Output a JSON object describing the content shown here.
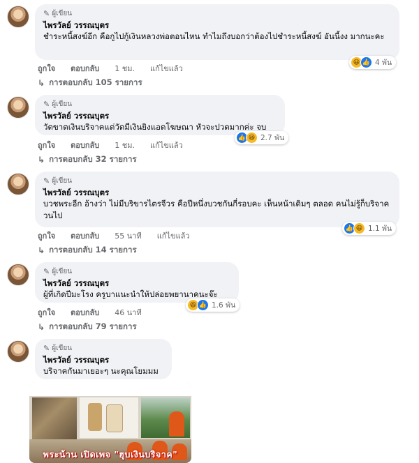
{
  "author_badge_label": "ผู้เขียน",
  "comments": [
    {
      "author": "ไพรวัลย์ วรรณบุตร",
      "text": "ชำระหนี้สงฆ์อีก คือกูไปกู้เงินหลวงพ่อตอนไหน ทำไมถึงบอกว่าต้องไปชำระหนี้สงฆ์ อันนี้งง มากนะคะ",
      "reaction_count": "4 พัน",
      "reactions": [
        "haha",
        "like"
      ],
      "like_label": "ถูกใจ",
      "reply_label": "ตอบกลับ",
      "time": "1 ชม.",
      "edited": "แก้ไขแล้ว",
      "replies": "การตอบกลับ 105 รายการ"
    },
    {
      "author": "ไพรวัลย์ วรรณบุตร",
      "text": "วัดขาดเงินบริจาคแต่วัดมีเงินยิงแอดโฆษณา หัวจะปวดมากค่ะ จบ",
      "reaction_count": "2.7 พัน",
      "reactions": [
        "like",
        "haha"
      ],
      "like_label": "ถูกใจ",
      "reply_label": "ตอบกลับ",
      "time": "1 ชม.",
      "edited": "แก้ไขแล้ว",
      "replies": "การตอบกลับ 32 รายการ"
    },
    {
      "author": "ไพรวัลย์ วรรณบุตร",
      "text": "บวชพระอีก อ้างว่า ไม่มีบริขารไตรจีวร คือปีหนึ่งบวชกันกี่รอบคะ เห็นหน้าเดิมๆ ตลอด คนไม่รู้ก็บริจาควนไป",
      "reaction_count": "1.1 พัน",
      "reactions": [
        "like",
        "haha"
      ],
      "like_label": "ถูกใจ",
      "reply_label": "ตอบกลับ",
      "time": "55 นาที",
      "edited": "แก้ไขแล้ว",
      "replies": "การตอบกลับ 14 รายการ"
    },
    {
      "author": "ไพรวัลย์ วรรณบุตร",
      "text": "ผู้ที่เกิดปีมะโรง ครูบาแนะนำให้ปล่อยพยานาคนะจ๊ะ",
      "reaction_count": "1.6 พัน",
      "reactions": [
        "haha",
        "like"
      ],
      "like_label": "ถูกใจ",
      "reply_label": "ตอบกลับ",
      "time": "46 นาที",
      "edited": "",
      "replies": "การตอบกลับ 79 รายการ"
    },
    {
      "author": "ไพรวัลย์ วรรณบุตร",
      "text": "บริจาคกันมาเยอะๆ นะคุณโยมมม",
      "attachment_caption": "พระน้าน เปิดเพจ \"ฮุบเงินบริจาค\""
    }
  ]
}
